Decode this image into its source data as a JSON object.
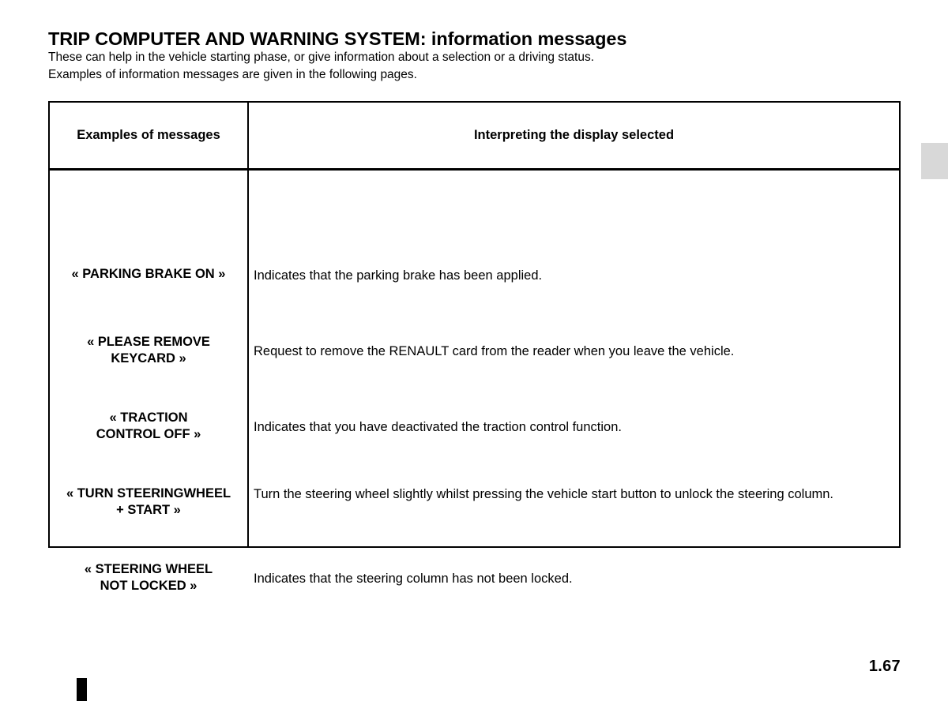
{
  "document": {
    "title_main": "TRIP COMPUTER AND WARNING SYSTEM:",
    "title_sub": " information messages",
    "intro_line_1": "These can help in the vehicle starting phase, or give information about a selection or a driving status.",
    "intro_line_2": "Examples of information messages are given in the following pages.",
    "page_number": "1.67"
  },
  "table": {
    "headers": {
      "col_messages": "Examples of messages",
      "col_interpretation": "Interpreting the display selected"
    },
    "rows": [
      {
        "message": "« PARKING BRAKE ON »",
        "message_line_1": "« PARKING BRAKE ON »",
        "message_line_2": "",
        "description": "Indicates that the parking brake has been applied."
      },
      {
        "message": "« PLEASE REMOVE KEYCARD »",
        "message_line_1": "« PLEASE REMOVE",
        "message_line_2": "KEYCARD »",
        "description": "Request to remove the RENAULT card from the reader when you leave the vehicle."
      },
      {
        "message": "« TRACTION CONTROL OFF »",
        "message_line_1": "« TRACTION",
        "message_line_2": "CONTROL OFF »",
        "description": "Indicates that you have deactivated the traction control function."
      },
      {
        "message": "« TURN STEERINGWHEEL + START »",
        "message_line_1": "« TURN STEERINGWHEEL",
        "message_line_2": "+ START »",
        "description": "Turn the steering wheel slightly whilst pressing the vehicle start button to unlock the steering column."
      },
      {
        "message": "« STEERING WHEEL NOT LOCKED »",
        "message_line_1": "« STEERING WHEEL",
        "message_line_2": "NOT LOCKED »",
        "description": "Indicates that the steering column has not been locked."
      }
    ]
  },
  "colors": {
    "text": "#000000",
    "page_background": "#ffffff",
    "side_tab": "#d8d8d8",
    "corner_mark": "#000000"
  }
}
